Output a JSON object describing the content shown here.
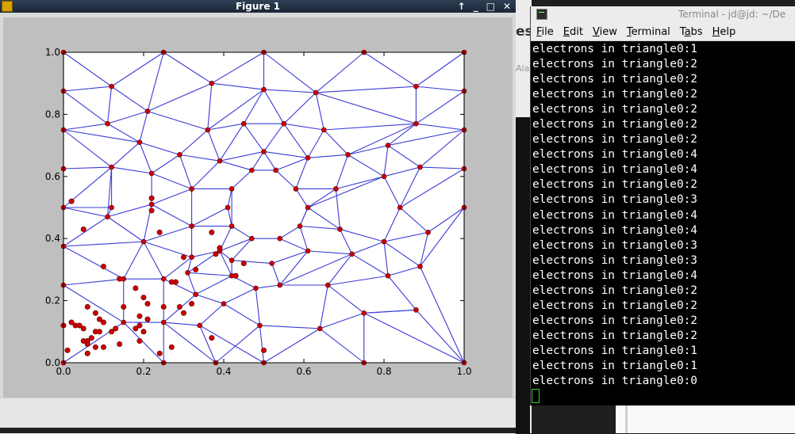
{
  "figure_window": {
    "title": "Figure 1",
    "controls": [
      "↑",
      "_",
      "□",
      "✕"
    ]
  },
  "terminal_window": {
    "title": "Terminal - jd@jd: ~/De",
    "menu": [
      {
        "label": "File",
        "underline": 0
      },
      {
        "label": "Edit",
        "underline": 0
      },
      {
        "label": "View",
        "underline": 0
      },
      {
        "label": "Terminal",
        "underline": 0
      },
      {
        "label": "Tabs",
        "underline": 1
      },
      {
        "label": "Help",
        "underline": 0
      }
    ],
    "lines": [
      "electrons in triangle0:1",
      "electrons in triangle0:2",
      "electrons in triangle0:2",
      "electrons in triangle0:2",
      "electrons in triangle0:2",
      "electrons in triangle0:2",
      "electrons in triangle0:2",
      "electrons in triangle0:4",
      "electrons in triangle0:4",
      "electrons in triangle0:2",
      "electrons in triangle0:3",
      "electrons in triangle0:4",
      "electrons in triangle0:4",
      "electrons in triangle0:3",
      "electrons in triangle0:3",
      "electrons in triangle0:4",
      "electrons in triangle0:2",
      "electrons in triangle0:2",
      "electrons in triangle0:2",
      "electrons in triangle0:2",
      "electrons in triangle0:1",
      "electrons in triangle0:1",
      "electrons in triangle0:0"
    ]
  },
  "background_window": {
    "visible_text": "es",
    "visible_text_2": "Ala"
  },
  "chart_data": {
    "type": "scatter",
    "title": "",
    "xlabel": "",
    "ylabel": "",
    "xlim": [
      0,
      1
    ],
    "ylim": [
      0,
      1
    ],
    "xticks": [
      "0.0",
      "0.2",
      "0.4",
      "0.6",
      "0.8",
      "1.0"
    ],
    "yticks": [
      "0.0",
      "0.2",
      "0.4",
      "0.6",
      "0.8",
      "1.0"
    ],
    "grid": false,
    "colors": {
      "mesh": "#3b3bd6",
      "points": "#cc0000",
      "point_edge": "#5a0000"
    },
    "mesh_nodes": [
      [
        0,
        1
      ],
      [
        0.25,
        1
      ],
      [
        0.5,
        1
      ],
      [
        0.75,
        1
      ],
      [
        1,
        1
      ],
      [
        0,
        0.875
      ],
      [
        0.12,
        0.89
      ],
      [
        0.37,
        0.9
      ],
      [
        0.5,
        0.88
      ],
      [
        0.63,
        0.87
      ],
      [
        0.88,
        0.89
      ],
      [
        1,
        0.875
      ],
      [
        0.21,
        0.81
      ],
      [
        0.11,
        0.77
      ],
      [
        0,
        0.75
      ],
      [
        0.36,
        0.75
      ],
      [
        0.45,
        0.77
      ],
      [
        0.55,
        0.77
      ],
      [
        0.65,
        0.75
      ],
      [
        0.88,
        0.77
      ],
      [
        1,
        0.75
      ],
      [
        0.19,
        0.71
      ],
      [
        0.29,
        0.67
      ],
      [
        0.39,
        0.65
      ],
      [
        0.5,
        0.68
      ],
      [
        0.61,
        0.66
      ],
      [
        0.71,
        0.67
      ],
      [
        0.81,
        0.7
      ],
      [
        0,
        0.625
      ],
      [
        0.12,
        0.63
      ],
      [
        0.22,
        0.61
      ],
      [
        0.47,
        0.62
      ],
      [
        0.53,
        0.62
      ],
      [
        0.8,
        0.6
      ],
      [
        0.89,
        0.63
      ],
      [
        1,
        0.625
      ],
      [
        0.32,
        0.56
      ],
      [
        0.42,
        0.56
      ],
      [
        0.58,
        0.56
      ],
      [
        0.68,
        0.56
      ],
      [
        0,
        0.5
      ],
      [
        0.22,
        0.51
      ],
      [
        0.41,
        0.5
      ],
      [
        0.61,
        0.5
      ],
      [
        0.84,
        0.5
      ],
      [
        1,
        0.5
      ],
      [
        0.11,
        0.47
      ],
      [
        0.32,
        0.44
      ],
      [
        0.42,
        0.44
      ],
      [
        0.59,
        0.44
      ],
      [
        0.69,
        0.43
      ],
      [
        0.47,
        0.4
      ],
      [
        0.54,
        0.4
      ],
      [
        0.2,
        0.39
      ],
      [
        0.8,
        0.39
      ],
      [
        0.91,
        0.42
      ],
      [
        0,
        0.375
      ],
      [
        0.39,
        0.36
      ],
      [
        0.61,
        0.36
      ],
      [
        0.72,
        0.35
      ],
      [
        0.32,
        0.34
      ],
      [
        0.42,
        0.33
      ],
      [
        0.52,
        0.32
      ],
      [
        0.89,
        0.31
      ],
      [
        0.31,
        0.29
      ],
      [
        0.42,
        0.28
      ],
      [
        0.54,
        0.25
      ],
      [
        0.66,
        0.25
      ],
      [
        0.81,
        0.28
      ],
      [
        0.15,
        0.27
      ],
      [
        0.25,
        0.27
      ],
      [
        0.33,
        0.22
      ],
      [
        0.48,
        0.24
      ],
      [
        0,
        0.25
      ],
      [
        0.4,
        0.19
      ],
      [
        0.75,
        0.16
      ],
      [
        0.88,
        0.17
      ],
      [
        0.25,
        0.13
      ],
      [
        0.15,
        0.13
      ],
      [
        0.34,
        0.12
      ],
      [
        0.49,
        0.12
      ],
      [
        0.64,
        0.11
      ],
      [
        0,
        0
      ],
      [
        0.25,
        0
      ],
      [
        0.5,
        0
      ],
      [
        0.75,
        0
      ],
      [
        1,
        0
      ],
      [
        0.38,
        0
      ],
      [
        0.12,
        0.5
      ]
    ],
    "mesh_edges": [
      [
        0,
        1
      ],
      [
        1,
        2
      ],
      [
        2,
        3
      ],
      [
        3,
        4
      ],
      [
        0,
        5
      ],
      [
        5,
        14
      ],
      [
        14,
        28
      ],
      [
        28,
        40
      ],
      [
        40,
        56
      ],
      [
        56,
        73
      ],
      [
        73,
        82
      ],
      [
        4,
        11
      ],
      [
        11,
        20
      ],
      [
        20,
        35
      ],
      [
        35,
        45
      ],
      [
        45,
        86
      ],
      [
        82,
        83
      ],
      [
        83,
        87
      ],
      [
        87,
        84
      ],
      [
        84,
        85
      ],
      [
        85,
        86
      ],
      [
        1,
        6
      ],
      [
        0,
        6
      ],
      [
        5,
        6
      ],
      [
        6,
        12
      ],
      [
        1,
        12
      ],
      [
        1,
        7
      ],
      [
        2,
        7
      ],
      [
        2,
        8
      ],
      [
        7,
        8
      ],
      [
        2,
        9
      ],
      [
        8,
        9
      ],
      [
        3,
        9
      ],
      [
        3,
        10
      ],
      [
        4,
        10
      ],
      [
        10,
        11
      ],
      [
        9,
        10
      ],
      [
        6,
        13
      ],
      [
        5,
        13
      ],
      [
        13,
        14
      ],
      [
        12,
        13
      ],
      [
        7,
        12
      ],
      [
        7,
        15
      ],
      [
        12,
        15
      ],
      [
        8,
        15
      ],
      [
        8,
        16
      ],
      [
        15,
        16
      ],
      [
        8,
        17
      ],
      [
        16,
        17
      ],
      [
        9,
        17
      ],
      [
        9,
        18
      ],
      [
        17,
        18
      ],
      [
        18,
        19
      ],
      [
        10,
        19
      ],
      [
        9,
        19
      ],
      [
        11,
        19
      ],
      [
        19,
        20
      ],
      [
        12,
        21
      ],
      [
        13,
        21
      ],
      [
        14,
        21
      ],
      [
        15,
        22
      ],
      [
        21,
        22
      ],
      [
        15,
        23
      ],
      [
        22,
        23
      ],
      [
        16,
        23
      ],
      [
        16,
        24
      ],
      [
        23,
        24
      ],
      [
        17,
        24
      ],
      [
        17,
        25
      ],
      [
        24,
        25
      ],
      [
        18,
        25
      ],
      [
        18,
        26
      ],
      [
        25,
        26
      ],
      [
        19,
        26
      ],
      [
        19,
        27
      ],
      [
        26,
        27
      ],
      [
        20,
        27
      ],
      [
        14,
        29
      ],
      [
        21,
        29
      ],
      [
        28,
        29
      ],
      [
        21,
        30
      ],
      [
        22,
        30
      ],
      [
        29,
        30
      ],
      [
        22,
        36
      ],
      [
        30,
        36
      ],
      [
        23,
        36
      ],
      [
        23,
        31
      ],
      [
        24,
        31
      ],
      [
        31,
        32
      ],
      [
        24,
        32
      ],
      [
        32,
        38
      ],
      [
        25,
        32
      ],
      [
        25,
        38
      ],
      [
        38,
        39
      ],
      [
        26,
        39
      ],
      [
        26,
        33
      ],
      [
        27,
        33
      ],
      [
        33,
        39
      ],
      [
        27,
        34
      ],
      [
        20,
        34
      ],
      [
        33,
        34
      ],
      [
        34,
        35
      ],
      [
        28,
        40
      ],
      [
        29,
        40
      ],
      [
        29,
        46
      ],
      [
        30,
        41
      ],
      [
        41,
        46
      ],
      [
        36,
        41
      ],
      [
        36,
        37
      ],
      [
        31,
        37
      ],
      [
        38,
        43
      ],
      [
        39,
        43
      ],
      [
        33,
        44
      ],
      [
        34,
        44
      ],
      [
        35,
        44
      ],
      [
        33,
        43
      ],
      [
        37,
        42
      ],
      [
        40,
        46
      ],
      [
        40,
        88
      ],
      [
        46,
        88
      ],
      [
        29,
        88
      ],
      [
        46,
        56
      ],
      [
        46,
        53
      ],
      [
        41,
        53
      ],
      [
        41,
        47
      ],
      [
        47,
        53
      ],
      [
        36,
        47
      ],
      [
        47,
        48
      ],
      [
        42,
        48
      ],
      [
        42,
        47
      ],
      [
        37,
        48
      ],
      [
        48,
        51
      ],
      [
        51,
        52
      ],
      [
        52,
        49
      ],
      [
        49,
        43
      ],
      [
        43,
        50
      ],
      [
        39,
        50
      ],
      [
        49,
        50
      ],
      [
        50,
        54
      ],
      [
        44,
        54
      ],
      [
        44,
        55
      ],
      [
        45,
        55
      ],
      [
        54,
        55
      ],
      [
        43,
        49
      ],
      [
        56,
        53
      ],
      [
        53,
        60
      ],
      [
        47,
        60
      ],
      [
        60,
        57
      ],
      [
        48,
        57
      ],
      [
        57,
        51
      ],
      [
        51,
        61
      ],
      [
        57,
        61
      ],
      [
        52,
        58
      ],
      [
        49,
        58
      ],
      [
        58,
        59
      ],
      [
        50,
        59
      ],
      [
        59,
        54
      ],
      [
        54,
        63
      ],
      [
        55,
        63
      ],
      [
        45,
        63
      ],
      [
        56,
        69
      ],
      [
        56,
        73
      ],
      [
        53,
        69
      ],
      [
        53,
        70
      ],
      [
        60,
        70
      ],
      [
        60,
        64
      ],
      [
        64,
        57
      ],
      [
        64,
        65
      ],
      [
        57,
        65
      ],
      [
        61,
        65
      ],
      [
        61,
        62
      ],
      [
        62,
        58
      ],
      [
        62,
        66
      ],
      [
        58,
        66
      ],
      [
        59,
        66
      ],
      [
        59,
        67
      ],
      [
        63,
        68
      ],
      [
        54,
        68
      ],
      [
        68,
        67
      ],
      [
        68,
        76
      ],
      [
        63,
        86
      ],
      [
        59,
        68
      ],
      [
        69,
        70
      ],
      [
        73,
        69
      ],
      [
        70,
        71
      ],
      [
        64,
        71
      ],
      [
        65,
        71
      ],
      [
        65,
        72
      ],
      [
        66,
        72
      ],
      [
        66,
        67
      ],
      [
        71,
        74
      ],
      [
        72,
        74
      ],
      [
        72,
        80
      ],
      [
        67,
        81
      ],
      [
        67,
        75
      ],
      [
        76,
        75
      ],
      [
        76,
        86
      ],
      [
        73,
        78
      ],
      [
        69,
        78
      ],
      [
        78,
        77
      ],
      [
        70,
        77
      ],
      [
        77,
        71
      ],
      [
        77,
        79
      ],
      [
        74,
        79
      ],
      [
        74,
        80
      ],
      [
        80,
        81
      ],
      [
        81,
        75
      ],
      [
        75,
        76
      ],
      [
        75,
        85
      ],
      [
        73,
        82
      ],
      [
        78,
        82
      ],
      [
        78,
        83
      ],
      [
        77,
        83
      ],
      [
        79,
        87
      ],
      [
        77,
        87
      ],
      [
        80,
        84
      ],
      [
        81,
        84
      ],
      [
        81,
        85
      ],
      [
        80,
        87
      ],
      [
        79,
        84
      ],
      [
        75,
        86
      ]
    ],
    "points": [
      [
        0.02,
        0.52
      ],
      [
        0.05,
        0.43
      ],
      [
        0.24,
        0.42
      ],
      [
        0.37,
        0.42
      ],
      [
        0.39,
        0.37
      ],
      [
        0.38,
        0.35
      ],
      [
        0.3,
        0.34
      ],
      [
        0.1,
        0.31
      ],
      [
        0.45,
        0.32
      ],
      [
        0.14,
        0.27
      ],
      [
        0.27,
        0.26
      ],
      [
        0.28,
        0.26
      ],
      [
        0.43,
        0.28
      ],
      [
        0.18,
        0.24
      ],
      [
        0.2,
        0.21
      ],
      [
        0.21,
        0.19
      ],
      [
        0.15,
        0.18
      ],
      [
        0.25,
        0.18
      ],
      [
        0.29,
        0.18
      ],
      [
        0.32,
        0.19
      ],
      [
        0.06,
        0.18
      ],
      [
        0.08,
        0.16
      ],
      [
        0.09,
        0.14
      ],
      [
        0.1,
        0.13
      ],
      [
        0.3,
        0.16
      ],
      [
        0.19,
        0.15
      ],
      [
        0.21,
        0.14
      ],
      [
        0,
        0.12
      ],
      [
        0.02,
        0.13
      ],
      [
        0.03,
        0.12
      ],
      [
        0.04,
        0.12
      ],
      [
        0.05,
        0.11
      ],
      [
        0.08,
        0.1
      ],
      [
        0.09,
        0.1
      ],
      [
        0.12,
        0.1
      ],
      [
        0.13,
        0.11
      ],
      [
        0.18,
        0.11
      ],
      [
        0.19,
        0.12
      ],
      [
        0.2,
        0.1
      ],
      [
        0.06,
        0.07
      ],
      [
        0.07,
        0.08
      ],
      [
        0.05,
        0.07
      ],
      [
        0.06,
        0.06
      ],
      [
        0.08,
        0.05
      ],
      [
        0.1,
        0.05
      ],
      [
        0.14,
        0.06
      ],
      [
        0.19,
        0.07
      ],
      [
        0.27,
        0.05
      ],
      [
        0.24,
        0.03
      ],
      [
        0.37,
        0.08
      ],
      [
        0.5,
        0.04
      ],
      [
        0.01,
        0.04
      ],
      [
        0.06,
        0.03
      ],
      [
        0.22,
        0.53
      ],
      [
        0.22,
        0.49
      ],
      [
        0.33,
        0.3
      ]
    ]
  }
}
